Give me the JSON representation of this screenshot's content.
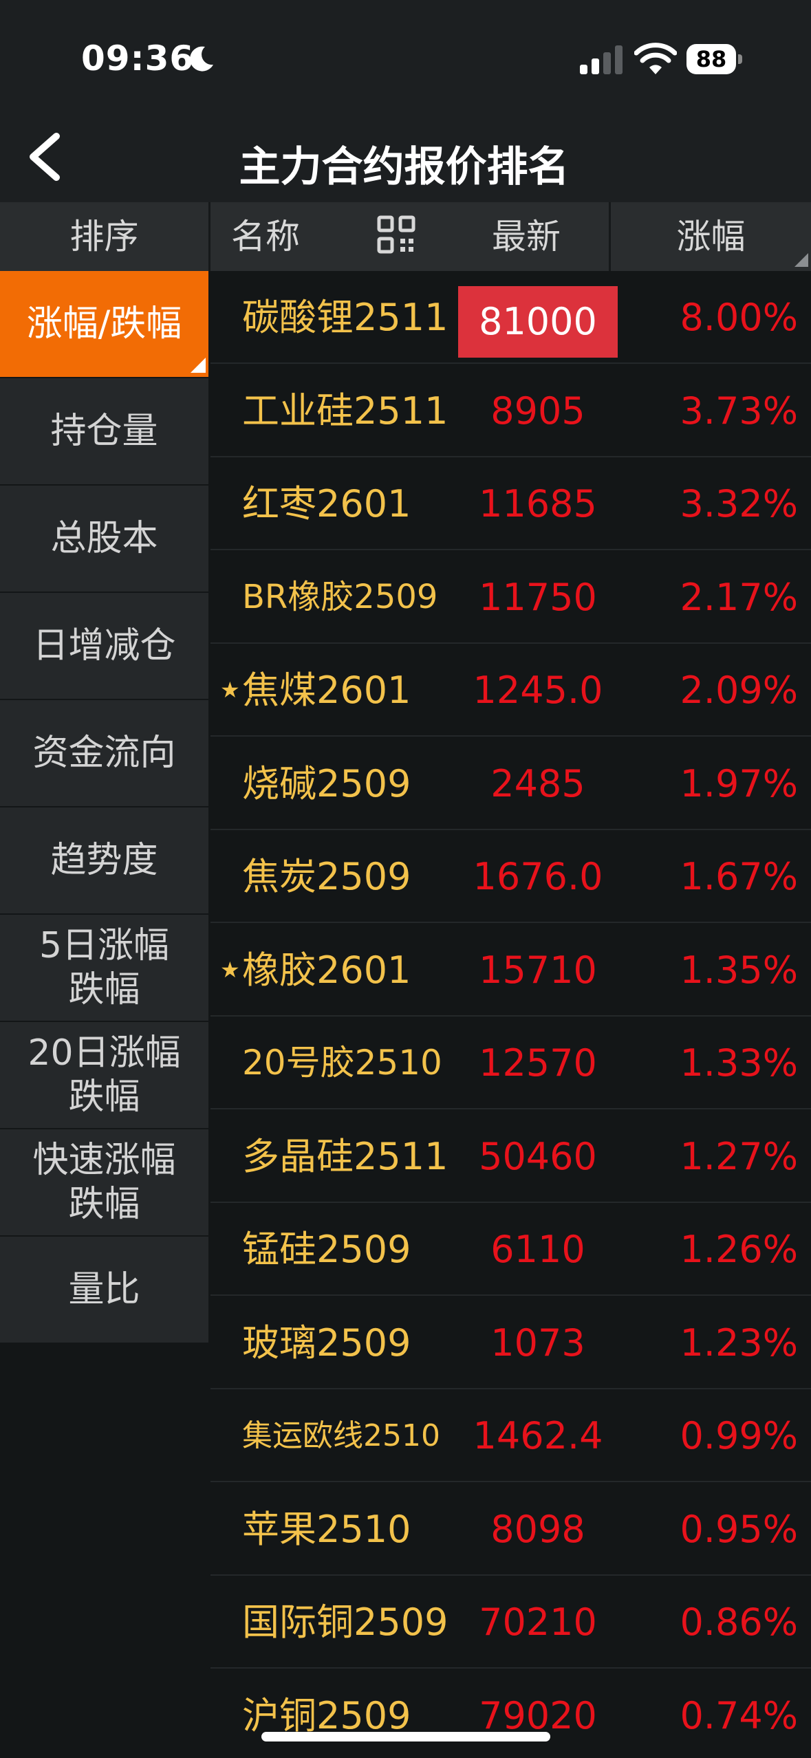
{
  "status": {
    "time": "09:36",
    "battery": "88"
  },
  "nav": {
    "title": "主力合约报价排名"
  },
  "header": {
    "sort": "排序",
    "name": "名称",
    "latest": "最新",
    "change": "涨幅"
  },
  "sidebar": {
    "items": [
      {
        "label": "涨幅/跌幅"
      },
      {
        "label": "持仓量"
      },
      {
        "label": "总股本"
      },
      {
        "label": "日增减仓"
      },
      {
        "label": "资金流向"
      },
      {
        "label": "趋势度"
      },
      {
        "line1": "5日涨幅",
        "line2": "跌幅"
      },
      {
        "line1": "20日涨幅",
        "line2": "跌幅"
      },
      {
        "line1": "快速涨幅",
        "line2": "跌幅"
      },
      {
        "label": "量比"
      }
    ]
  },
  "rows": [
    {
      "name": "碳酸锂2511",
      "price": "81000",
      "change": "8.00%",
      "starred": false
    },
    {
      "name": "工业硅2511",
      "price": "8905",
      "change": "3.73%",
      "starred": false
    },
    {
      "name": "红枣2601",
      "price": "11685",
      "change": "3.32%",
      "starred": false
    },
    {
      "name": "BR橡胶2509",
      "price": "11750",
      "change": "2.17%",
      "starred": false
    },
    {
      "name": "焦煤2601",
      "price": "1245.0",
      "change": "2.09%",
      "starred": true
    },
    {
      "name": "烧碱2509",
      "price": "2485",
      "change": "1.97%",
      "starred": false
    },
    {
      "name": "焦炭2509",
      "price": "1676.0",
      "change": "1.67%",
      "starred": false
    },
    {
      "name": "橡胶2601",
      "price": "15710",
      "change": "1.35%",
      "starred": true
    },
    {
      "name": "20号胶2510",
      "price": "12570",
      "change": "1.33%",
      "starred": false
    },
    {
      "name": "多晶硅2511",
      "price": "50460",
      "change": "1.27%",
      "starred": false
    },
    {
      "name": "锰硅2509",
      "price": "6110",
      "change": "1.26%",
      "starred": false
    },
    {
      "name": "玻璃2509",
      "price": "1073",
      "change": "1.23%",
      "starred": false
    },
    {
      "name": "集运欧线2510",
      "price": "1462.4",
      "change": "0.99%",
      "starred": false
    },
    {
      "name": "苹果2510",
      "price": "8098",
      "change": "0.95%",
      "starred": false
    },
    {
      "name": "国际铜2509",
      "price": "70210",
      "change": "0.86%",
      "starred": false
    },
    {
      "name": "沪铜2509",
      "price": "79020",
      "change": "0.74%",
      "starred": false
    }
  ],
  "colors": {
    "accent": "#f26c05",
    "up": "#e8121b",
    "name": "#f3c24b",
    "highlight": "#dc323c"
  }
}
